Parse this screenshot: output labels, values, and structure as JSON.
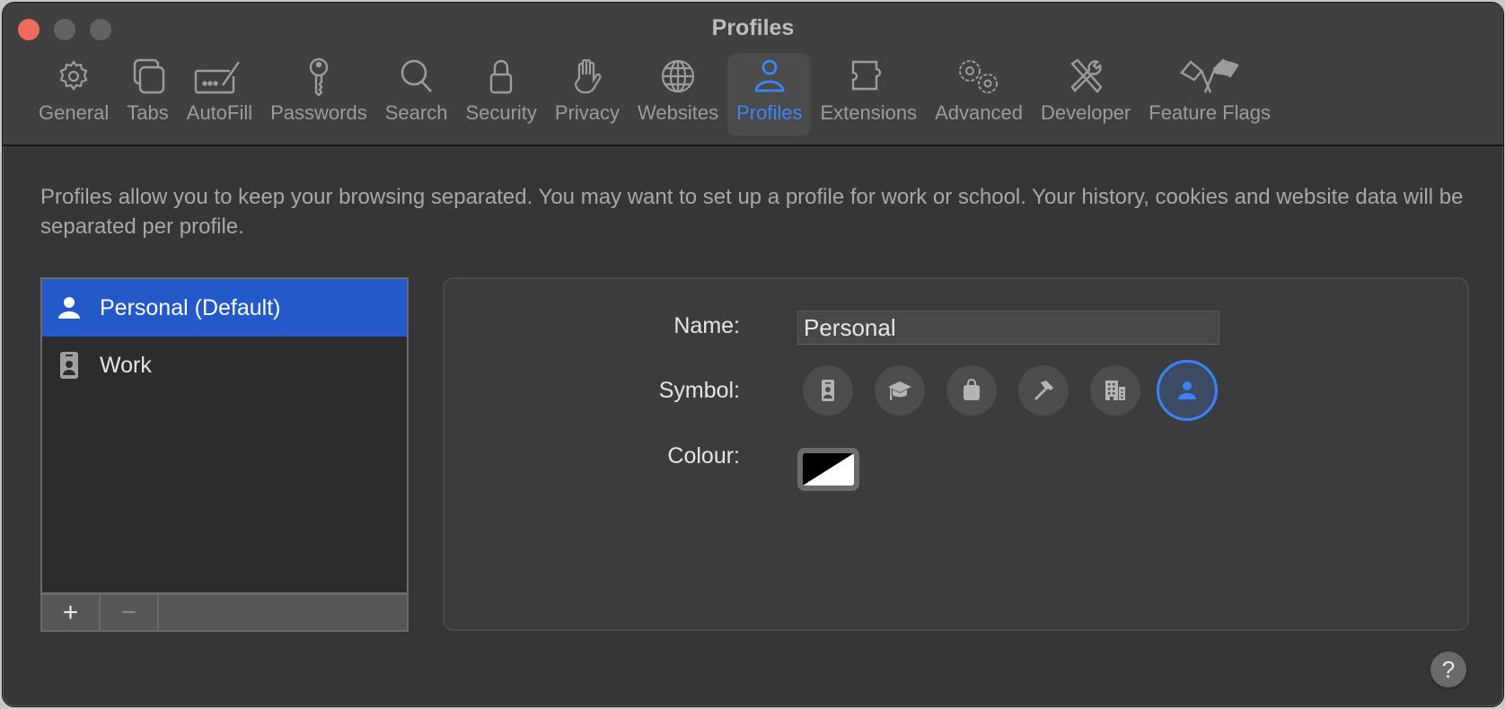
{
  "window": {
    "title": "Profiles",
    "traffic_lights": [
      "close",
      "minimize",
      "zoom"
    ]
  },
  "toolbar": {
    "tabs": [
      {
        "label": "General",
        "icon": "gear-icon"
      },
      {
        "label": "Tabs",
        "icon": "tabs-icon"
      },
      {
        "label": "AutoFill",
        "icon": "autofill-icon"
      },
      {
        "label": "Passwords",
        "icon": "key-icon"
      },
      {
        "label": "Search",
        "icon": "search-icon"
      },
      {
        "label": "Security",
        "icon": "lock-icon"
      },
      {
        "label": "Privacy",
        "icon": "hand-icon"
      },
      {
        "label": "Websites",
        "icon": "globe-icon"
      },
      {
        "label": "Profiles",
        "icon": "person-icon",
        "active": true
      },
      {
        "label": "Extensions",
        "icon": "puzzle-icon"
      },
      {
        "label": "Advanced",
        "icon": "gears-icon"
      },
      {
        "label": "Developer",
        "icon": "tools-icon"
      },
      {
        "label": "Feature Flags",
        "icon": "flags-icon"
      }
    ],
    "active_color": "#3b86f7"
  },
  "description": "Profiles allow you to keep your browsing separated. You may want to set up a profile for work or school. Your history, cookies and website data will be separated per profile.",
  "profiles_list": {
    "items": [
      {
        "label": "Personal (Default)",
        "icon": "person-fill-icon",
        "selected": true
      },
      {
        "label": "Work",
        "icon": "id-badge-icon",
        "selected": false
      }
    ],
    "add_label": "+",
    "remove_label": "−",
    "selection_color": "#2359c9"
  },
  "detail": {
    "name_label": "Name:",
    "name_value": "Personal",
    "symbol_label": "Symbol:",
    "symbols": [
      {
        "name": "id-badge",
        "selected": false
      },
      {
        "name": "graduation-cap",
        "selected": false
      },
      {
        "name": "shopping-bag",
        "selected": false
      },
      {
        "name": "hammer",
        "selected": false
      },
      {
        "name": "building",
        "selected": false
      },
      {
        "name": "person",
        "selected": true
      }
    ],
    "colour_label": "Colour:",
    "colour_value": "black/white (default)"
  },
  "help": {
    "label": "?"
  }
}
